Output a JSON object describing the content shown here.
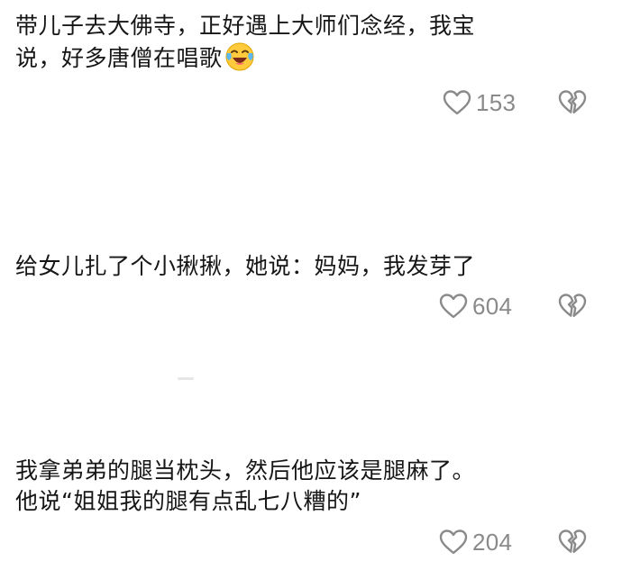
{
  "comments": [
    {
      "line1": "带儿子去大佛寺，正好遇上大师们念经，我宝",
      "line2": "说，好多唐僧在唱歌",
      "emoji": "crying-laughing-emoji",
      "likes": "153"
    },
    {
      "line1": "给女儿扎了个小揪揪，她说：妈妈，我发芽了",
      "likes": "604"
    },
    {
      "line1": "我拿弟弟的腿当枕头，然后他应该是腿麻了。",
      "line2": "他说“姐姐我的腿有点乱七八糟的”",
      "likes": "204"
    }
  ],
  "icons": {
    "like": "heart-outline-icon",
    "dislike": "broken-heart-icon"
  },
  "colors": {
    "text": "#161616",
    "count": "#8a8a8a",
    "icon": "#8a8a8a",
    "background": "#ffffff"
  }
}
